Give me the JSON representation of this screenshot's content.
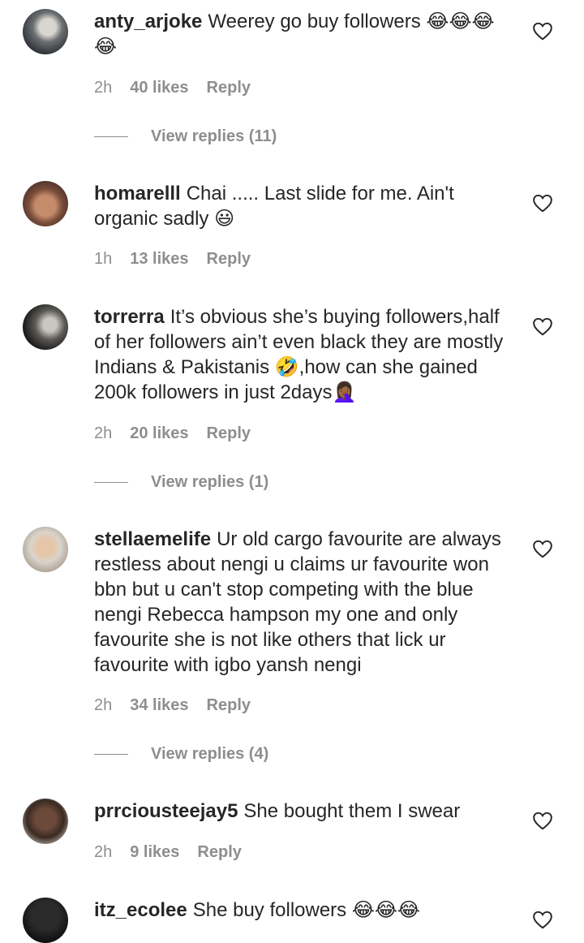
{
  "comments": [
    {
      "username": "anty_arjoke",
      "text": "Weerey go buy followers 😂😂😂😂",
      "time": "2h",
      "likes": "40 likes",
      "reply": "Reply",
      "view_replies": "View replies (11)"
    },
    {
      "username": "homarelll",
      "text": "Chai ..... Last slide for me. Ain't organic sadly 😃",
      "time": "1h",
      "likes": "13 likes",
      "reply": "Reply"
    },
    {
      "username": "torrerra",
      "text": "It’s obvious she’s buying followers,half of her followers ain’t even black they are mostly Indians & Pakistanis 🤣,how can she gained 200k followers in just 2days🤦🏾‍♀️",
      "time": "2h",
      "likes": "20 likes",
      "reply": "Reply",
      "view_replies": "View replies (1)"
    },
    {
      "username": "stellaemelife",
      "text": "Ur old cargo favourite are always restless about nengi u claims ur favourite won bbn but u can't stop competing with the blue nengi Rebecca hampson my one and only favourite she is not like others that lick ur favourite with igbo yansh nengi",
      "time": "2h",
      "likes": "34 likes",
      "reply": "Reply",
      "view_replies": "View replies (4)"
    },
    {
      "username": "prrciousteejay5",
      "text": "She bought them I swear",
      "time": "2h",
      "likes": "9 likes",
      "reply": "Reply"
    },
    {
      "username": "itz_ecolee",
      "text": "She buy followers 😂😂😂",
      "time": "",
      "likes": "",
      "reply": ""
    }
  ],
  "icons": {
    "like": "heart-outline-icon"
  },
  "colors": {
    "text": "#262626",
    "meta": "#8e8e8e"
  }
}
